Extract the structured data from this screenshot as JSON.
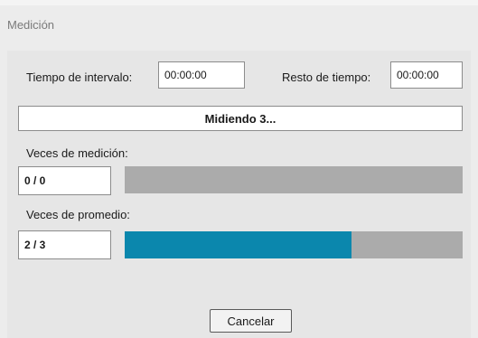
{
  "window": {
    "title": "Medición"
  },
  "interval": {
    "label": "Tiempo de intervalo:",
    "value": "00:00:00"
  },
  "remaining": {
    "label": "Resto de tiempo:",
    "value": "00:00:00"
  },
  "status": {
    "text": "Midiendo 3..."
  },
  "measurement": {
    "label": "Veces de medición:",
    "count": "0 / 0",
    "progress_fraction": 0.0
  },
  "average": {
    "label": "Veces de promedio:",
    "count": "2 / 3",
    "progress_fraction": 0.67
  },
  "buttons": {
    "cancel_label": "Cancelar"
  },
  "colors": {
    "progress_fill": "#0b87ad",
    "progress_track": "#ababab"
  }
}
